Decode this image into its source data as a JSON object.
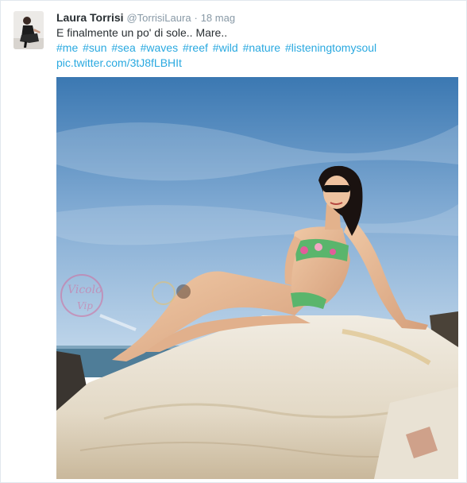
{
  "tweet": {
    "author_name": "Laura Torrisi",
    "author_handle": "@TorrisiLaura",
    "separator": "·",
    "timestamp": "18 mag",
    "text": "E finalmente un po' di sole.. Mare..",
    "hashtags": [
      "#me",
      "#sun",
      "#sea",
      "#waves",
      "#reef",
      "#wild",
      "#nature",
      "#listeningtomysoul"
    ],
    "link": "pic.twitter.com/3tJ8fLBHIt"
  },
  "photo": {
    "watermark_text": "Vicolo Vip",
    "subject": "woman in floral bikini and sunglasses sitting on a white rock by the sea"
  },
  "colors": {
    "link": "#2aa9e0",
    "text": "#292f33",
    "muted": "#8899a6",
    "sky_top": "#3f7fb8",
    "sky_bottom": "#b9d2e8"
  }
}
